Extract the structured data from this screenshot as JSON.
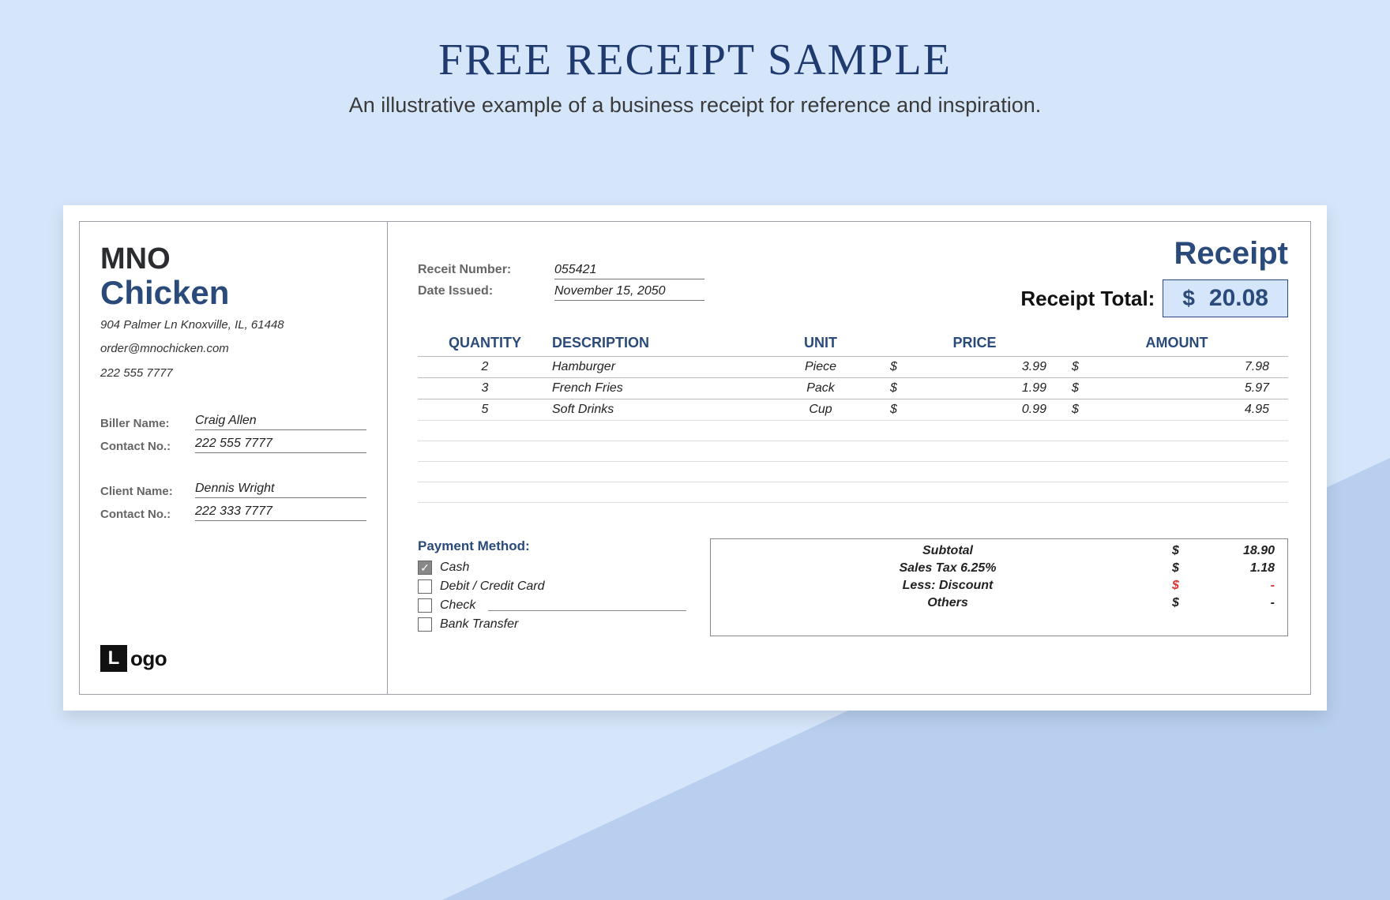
{
  "page": {
    "title": "FREE RECEIPT SAMPLE",
    "subtitle": "An illustrative example of a business receipt for reference and inspiration."
  },
  "company": {
    "name_line1": "MNO",
    "name_line2": "Chicken",
    "address": "904 Palmer Ln Knoxville, IL, 61448",
    "email": "order@mnochicken.com",
    "phone": "222 555 7777"
  },
  "biller": {
    "name_label": "Biller Name:",
    "name": "Craig Allen",
    "contact_label": "Contact No.:",
    "contact": "222 555 7777"
  },
  "client": {
    "name_label": "Client Name:",
    "name": "Dennis Wright",
    "contact_label": "Contact No.:",
    "contact": "222 333 7777"
  },
  "logo": {
    "letter": "L",
    "text": "ogo"
  },
  "meta": {
    "receipt_number_label": "Receit Number:",
    "receipt_number": "055421",
    "date_label": "Date Issued:",
    "date": "November 15, 2050"
  },
  "receipt": {
    "header": "Receipt",
    "total_label": "Receipt Total:",
    "currency": "$",
    "total": "20.08"
  },
  "columns": {
    "qty": "QUANTITY",
    "desc": "DESCRIPTION",
    "unit": "UNIT",
    "price": "PRICE",
    "amount": "AMOUNT"
  },
  "items": [
    {
      "qty": "2",
      "desc": "Hamburger",
      "unit": "Piece",
      "priceCur": "$",
      "price": "3.99",
      "amtCur": "$",
      "amount": "7.98"
    },
    {
      "qty": "3",
      "desc": "French Fries",
      "unit": "Pack",
      "priceCur": "$",
      "price": "1.99",
      "amtCur": "$",
      "amount": "5.97"
    },
    {
      "qty": "5",
      "desc": "Soft Drinks",
      "unit": "Cup",
      "priceCur": "$",
      "price": "0.99",
      "amtCur": "$",
      "amount": "4.95"
    }
  ],
  "payment": {
    "title": "Payment Method:",
    "options": [
      {
        "label": "Cash",
        "checked": true
      },
      {
        "label": "Debit / Credit Card",
        "checked": false
      },
      {
        "label": "Check",
        "checked": false,
        "hasLine": true
      },
      {
        "label": "Bank Transfer",
        "checked": false
      }
    ]
  },
  "summary": [
    {
      "label": "Subtotal",
      "cur": "$",
      "val": "18.90",
      "red": false
    },
    {
      "label": "Sales Tax 6.25%",
      "cur": "$",
      "val": "1.18",
      "red": false
    },
    {
      "label": "Less: Discount",
      "cur": "$",
      "val": "-",
      "red": true
    },
    {
      "label": "Others",
      "cur": "$",
      "val": "-",
      "red": false
    }
  ]
}
